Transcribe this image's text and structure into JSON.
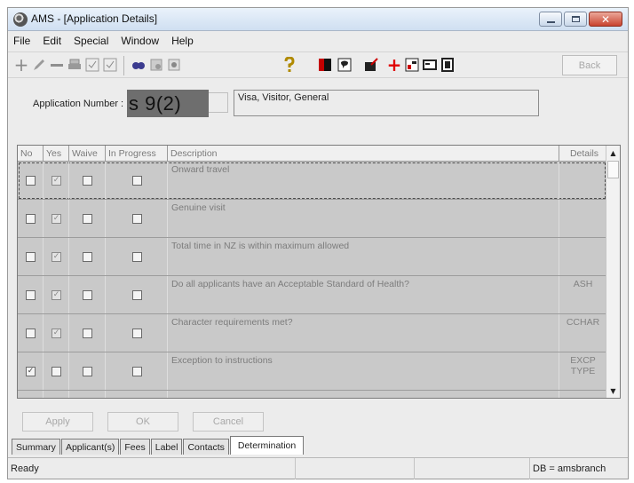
{
  "window": {
    "title": "AMS - [Application Details]",
    "controls": {
      "minimize": "minimize",
      "maximize": "maximize",
      "close": "✕"
    }
  },
  "menu": [
    "File",
    "Edit",
    "Special",
    "Window",
    "Help"
  ],
  "toolbar": {
    "left_icons": [
      "add-icon",
      "edit-pencil-icon",
      "remove-icon",
      "print-icon",
      "check-x-icon",
      "check-icon",
      "search-binoculars-icon",
      "forms-icon",
      "settings-icon"
    ],
    "middle_icons": [
      "help-question-icon",
      "document-red-icon",
      "comment-bubble-icon",
      "folder-edit-icon",
      "medical-cross-icon",
      "report-icon",
      "card-icon",
      "notes-icon"
    ],
    "back_label": "Back"
  },
  "application": {
    "number_label": "Application Number :",
    "number_value": "s 9(2)",
    "type_text": "Visa, Visitor, General"
  },
  "grid": {
    "columns": [
      "No",
      "Yes",
      "Waive",
      "In Progress",
      "Description",
      "Details"
    ],
    "rows": [
      {
        "no": false,
        "yes": true,
        "waive": false,
        "in_progress": false,
        "description": "Onward travel",
        "details": ""
      },
      {
        "no": false,
        "yes": true,
        "waive": false,
        "in_progress": false,
        "description": "Genuine visit",
        "details": ""
      },
      {
        "no": false,
        "yes": true,
        "waive": false,
        "in_progress": false,
        "description": "Total time in NZ is within maximum allowed",
        "details": ""
      },
      {
        "no": false,
        "yes": true,
        "waive": false,
        "in_progress": false,
        "description": "Do all applicants have an Acceptable Standard of Health?",
        "details": "ASH"
      },
      {
        "no": false,
        "yes": true,
        "waive": false,
        "in_progress": false,
        "description": "Character requirements met?",
        "details": "CCHAR"
      },
      {
        "no": true,
        "yes": false,
        "waive": false,
        "in_progress": false,
        "description": "Exception to instructions",
        "details": "EXCP TYPE"
      }
    ]
  },
  "buttons": {
    "apply": "Apply",
    "ok": "OK",
    "cancel": "Cancel"
  },
  "tabs": [
    "Summary",
    "Applicant(s)",
    "Fees",
    "Label",
    "Contacts",
    "Determination"
  ],
  "active_tab": "Determination",
  "status": {
    "left": "Ready",
    "db": "DB = amsbranch"
  }
}
